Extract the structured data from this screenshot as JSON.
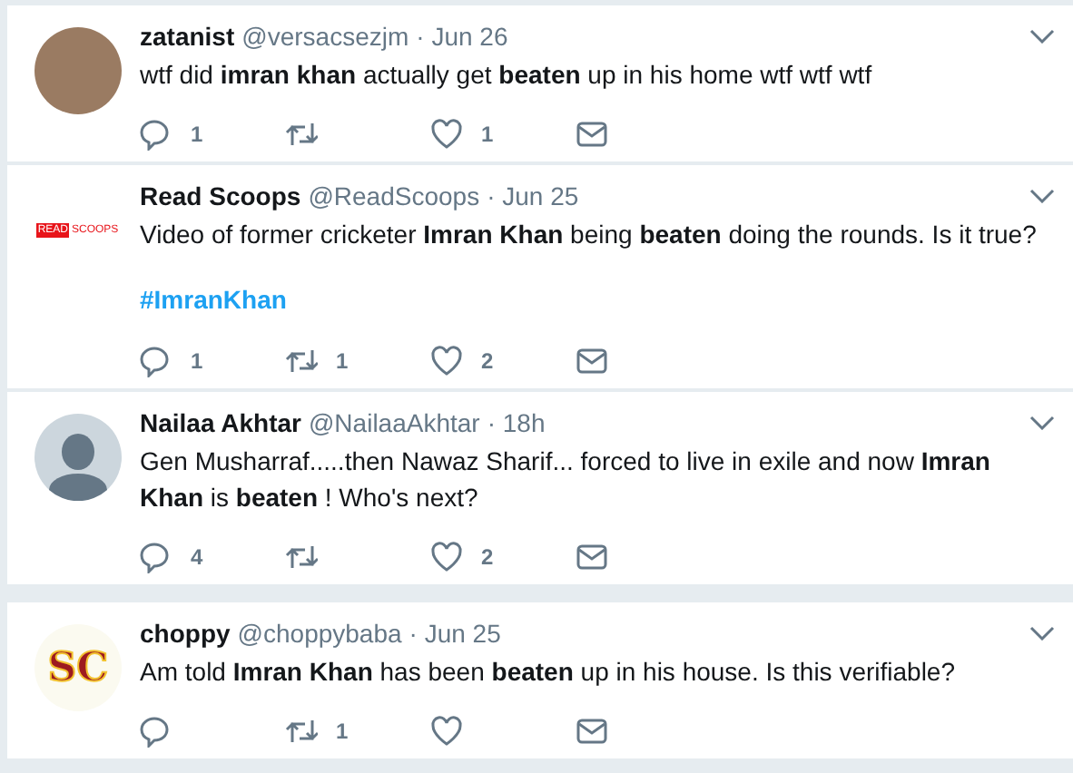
{
  "tweets": [
    {
      "name": "zatanist",
      "handle": "@versacsezjm",
      "time": "· Jun 26",
      "avatar": {
        "kind": "photo"
      },
      "text": "wtf did **imran khan** actually get **beaten** up in his home wtf wtf wtf",
      "replies": "1",
      "likes": "1"
    },
    {
      "name": "Read Scoops",
      "handle": "@ReadScoops",
      "time": "· Jun 25",
      "avatar": {
        "kind": "logo",
        "words": [
          "READ",
          "SCOOPS"
        ]
      },
      "text": "Video of former cricketer **Imran Khan** being **beaten** doing the rounds. Is it true?",
      "hashtag": "#ImranKhan",
      "replies": "1",
      "retweets": "1",
      "likes": "2"
    },
    {
      "name": "Nailaa Akhtar",
      "handle": "@NailaaAkhtar",
      "time": "· 18h",
      "avatar": {
        "kind": "default"
      },
      "text": "Gen Musharraf.....then Nawaz Sharif...  forced to live in exile and now **Imran Khan** is **beaten** ! Who's next?",
      "replies": "4",
      "likes": "2"
    },
    {
      "name": "choppy",
      "handle": "@choppybaba",
      "time": "· Jun 25",
      "avatar": {
        "kind": "monogram",
        "letters": "SC"
      },
      "text": "Am told **Imran Khan** has been **beaten** up in his house. Is this verifiable?",
      "retweets": "1"
    }
  ]
}
